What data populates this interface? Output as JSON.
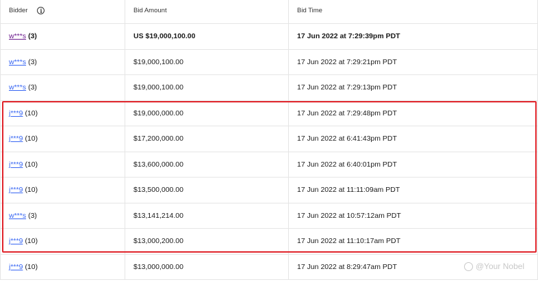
{
  "header": {
    "bidder": "Bidder",
    "bid_amount": "Bid Amount",
    "bid_time": "Bid Time"
  },
  "rows": [
    {
      "bidder": "w***s",
      "count": "(3)",
      "amount": "US $19,000,100.00",
      "time": "17 Jun 2022 at 7:29:39pm PDT",
      "bold": true
    },
    {
      "bidder": "w***s",
      "count": "(3)",
      "amount": "$19,000,100.00",
      "time": "17 Jun 2022 at 7:29:21pm PDT"
    },
    {
      "bidder": "w***s",
      "count": "(3)",
      "amount": "$19,000,100.00",
      "time": "17 Jun 2022 at 7:29:13pm PDT"
    },
    {
      "bidder": "j***9",
      "count": "(10)",
      "amount": "$19,000,000.00",
      "time": "17 Jun 2022 at 7:29:48pm PDT"
    },
    {
      "bidder": "j***9",
      "count": "(10)",
      "amount": "$17,200,000.00",
      "time": "17 Jun 2022 at 6:41:43pm PDT"
    },
    {
      "bidder": "j***9",
      "count": "(10)",
      "amount": "$13,600,000.00",
      "time": "17 Jun 2022 at 6:40:01pm PDT"
    },
    {
      "bidder": "j***9",
      "count": "(10)",
      "amount": "$13,500,000.00",
      "time": "17 Jun 2022 at 11:11:09am PDT"
    },
    {
      "bidder": "w***s",
      "count": "(3)",
      "amount": "$13,141,214.00",
      "time": "17 Jun 2022 at 10:57:12am PDT"
    },
    {
      "bidder": "j***9",
      "count": "(10)",
      "amount": "$13,000,200.00",
      "time": "17 Jun 2022 at 11:10:17am PDT"
    },
    {
      "bidder": "j***9",
      "count": "(10)",
      "amount": "$13,000,000.00",
      "time": "17 Jun 2022 at 8:29:47am PDT"
    }
  ],
  "watermark": "@Your Nobel",
  "colors": {
    "link": "#3665f3",
    "visited_link": "#6b1a8c",
    "highlight": "#e0232a"
  }
}
